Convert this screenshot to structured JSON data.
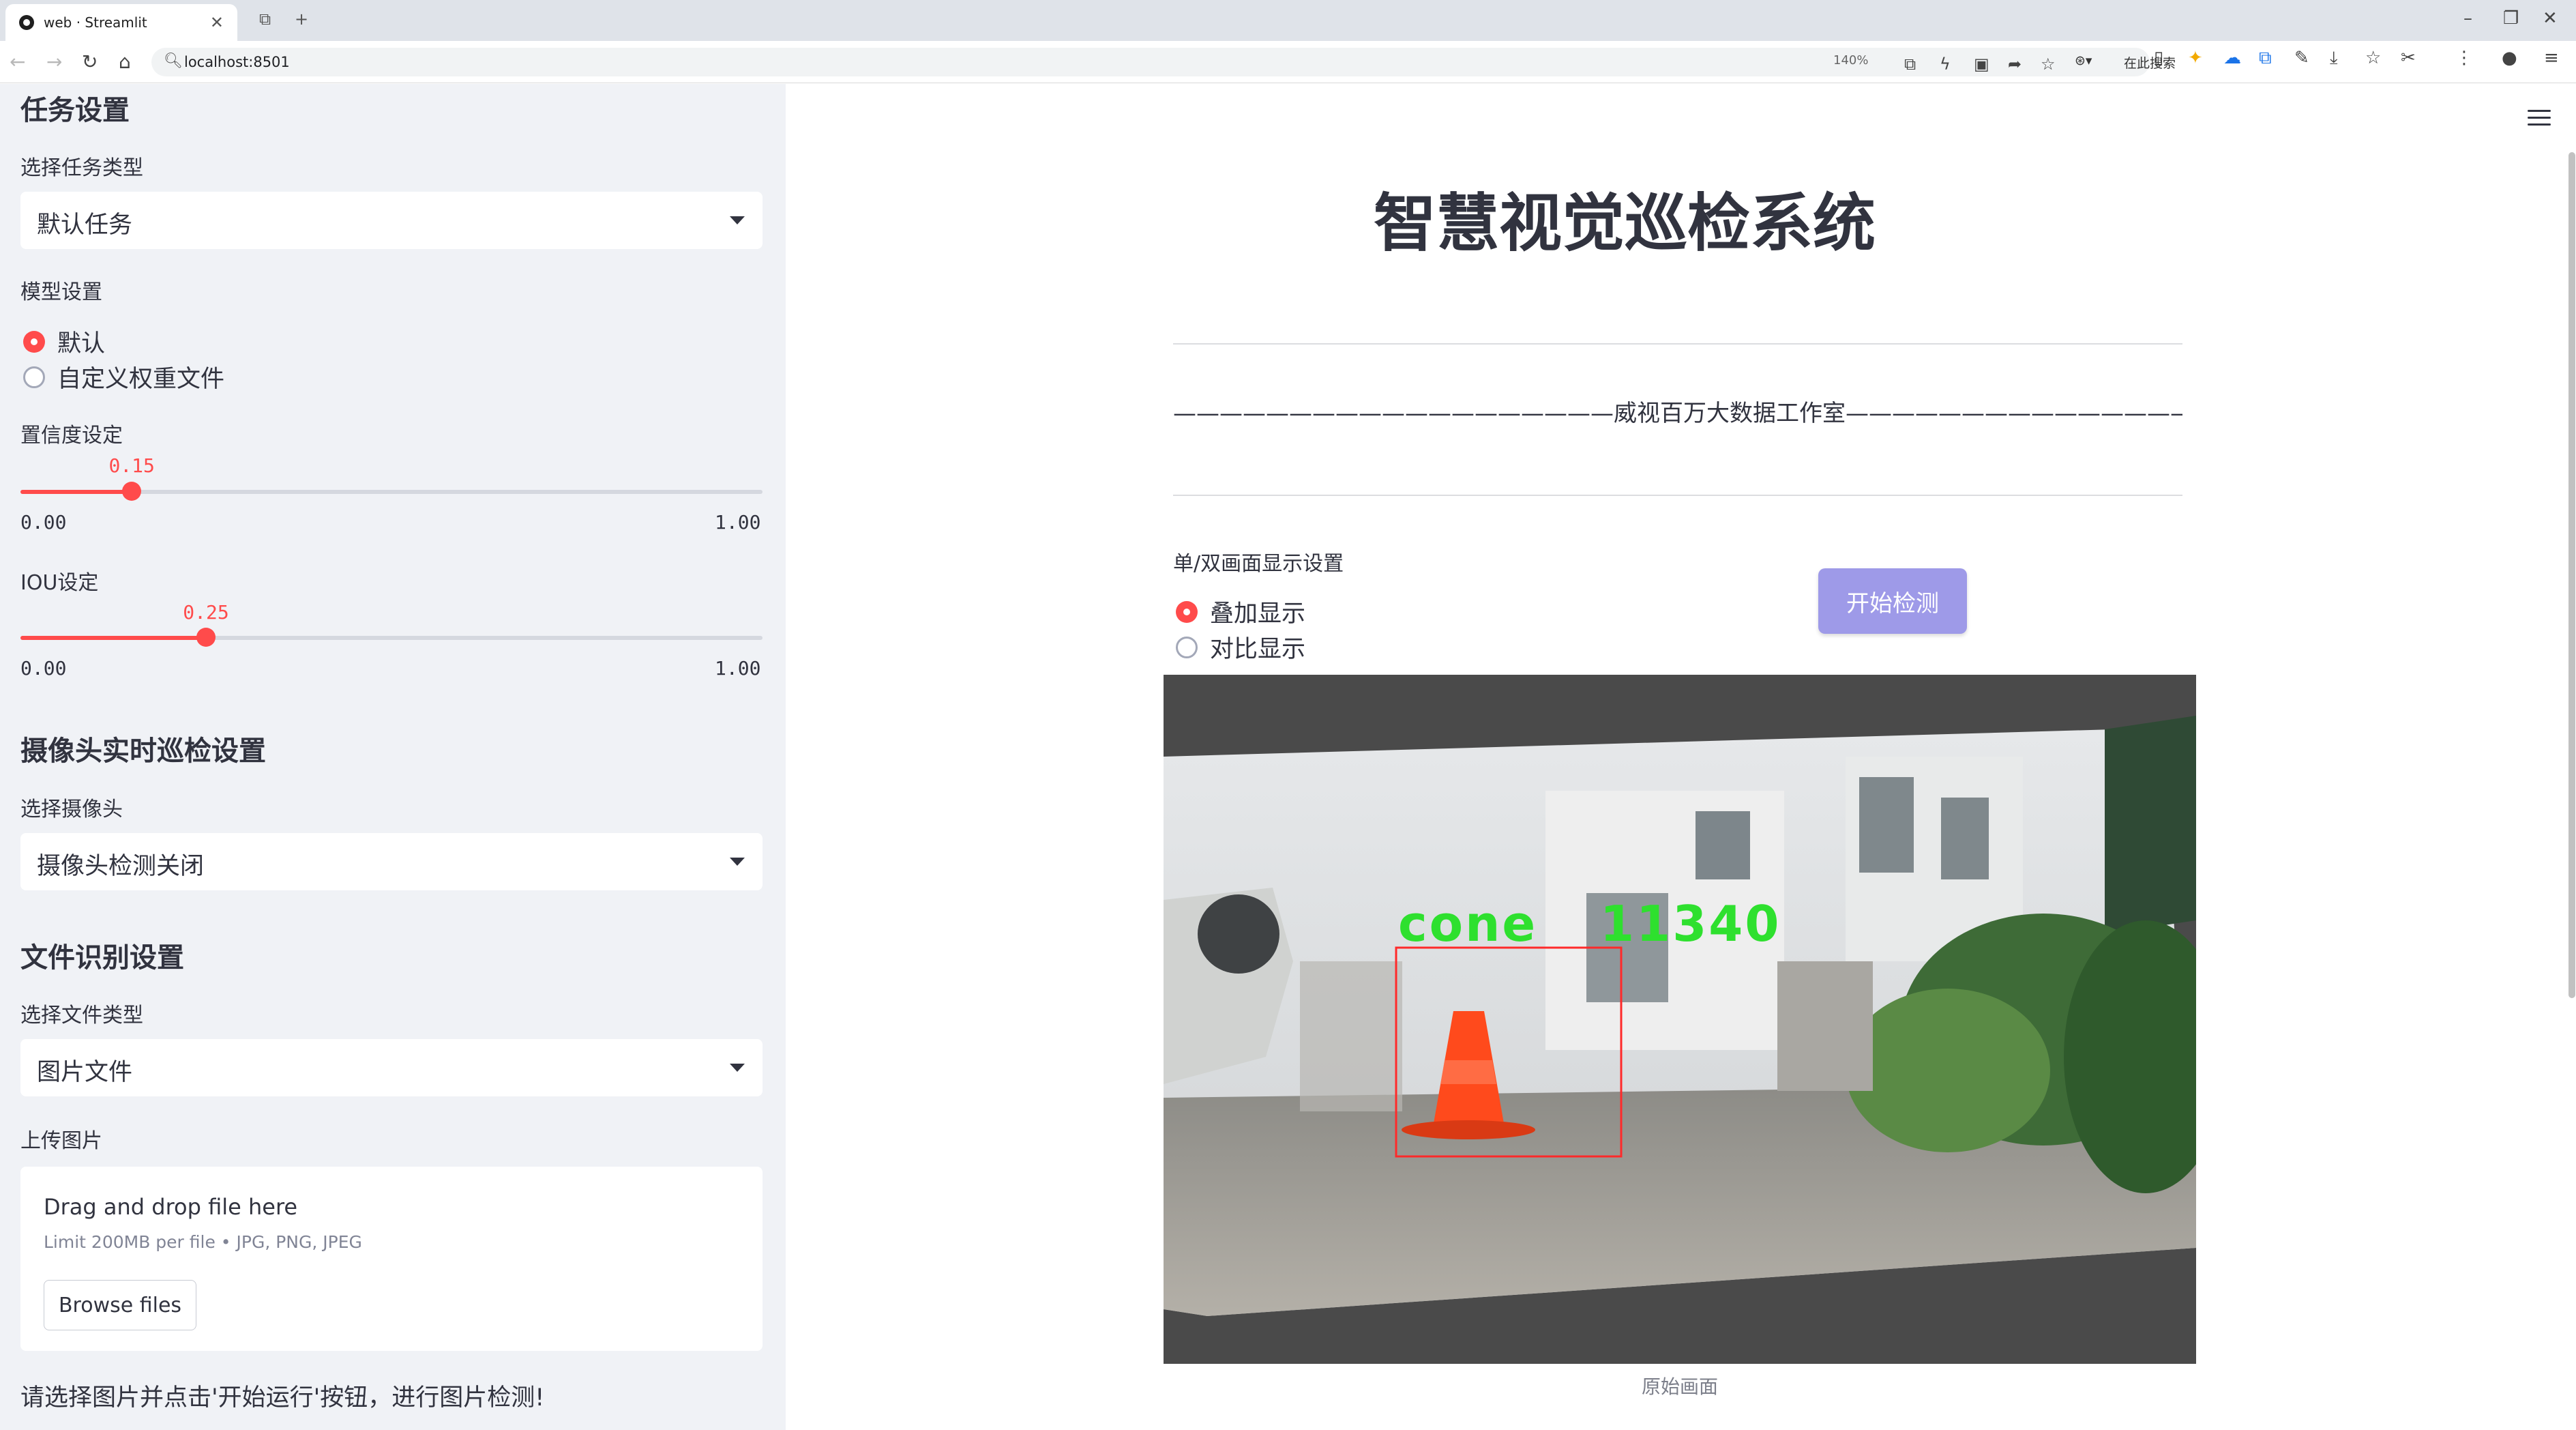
{
  "browser": {
    "tab_title": "web · Streamlit",
    "url": "localhost:8501",
    "zoom": "140%",
    "search_placeholder": "在此搜索"
  },
  "sidebar": {
    "task_heading": "任务设置",
    "task_type_label": "选择任务类型",
    "task_type_value": "默认任务",
    "model_label": "模型设置",
    "model_options": [
      "默认",
      "自定义权重文件"
    ],
    "model_selected": "默认",
    "conf_label": "置信度设定",
    "conf": {
      "value": 0.15,
      "value_text": "0.15",
      "min": "0.00",
      "max": "1.00"
    },
    "iou_label": "IOU设定",
    "iou": {
      "value": 0.25,
      "value_text": "0.25",
      "min": "0.00",
      "max": "1.00"
    },
    "camera_heading": "摄像头实时巡检设置",
    "camera_label": "选择摄像头",
    "camera_value": "摄像头检测关闭",
    "file_heading": "文件识别设置",
    "file_type_label": "选择文件类型",
    "file_type_value": "图片文件",
    "upload_label": "上传图片",
    "upload": {
      "title": "Drag and drop file here",
      "hint": "Limit 200MB per file • JPG, PNG, JPEG",
      "button": "Browse files"
    },
    "message": "请选择图片并点击'开始运行'按钮，进行图片检测!"
  },
  "main": {
    "title": "智慧视觉巡检系统",
    "studio_line": "———————————————————威视百万大数据工作室————————————————————",
    "display_label": "单/双画面显示设置",
    "display_options": [
      "叠加显示",
      "对比显示"
    ],
    "display_selected": "叠加显示",
    "start_button": "开始检测",
    "detection": {
      "label": "cone",
      "score": "11340"
    },
    "caption": "原始画面"
  },
  "colors": {
    "accent": "#ff4b4b",
    "button": "#9e9ae8",
    "sidebar_bg": "#f0f2f6",
    "box": "#ff2a2a",
    "detection_text": "#2ee02e"
  }
}
